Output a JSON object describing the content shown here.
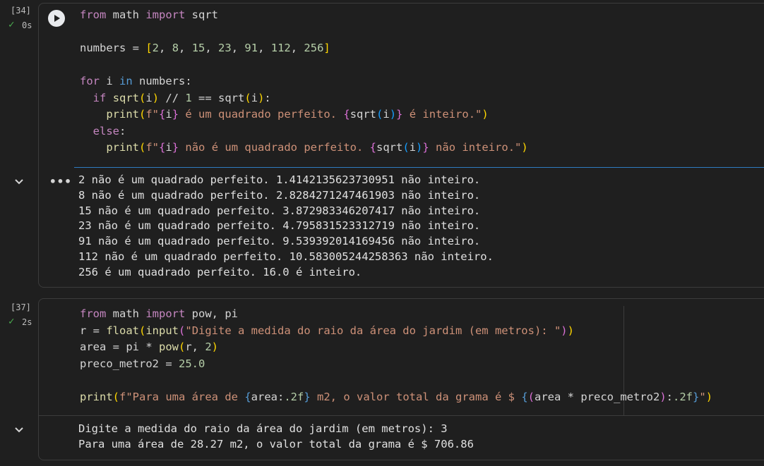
{
  "cell1": {
    "exec_count": "[34]",
    "time": "0s",
    "code": [
      [
        [
          "from",
          "kw"
        ],
        [
          " math ",
          "plain"
        ],
        [
          "import",
          "kw"
        ],
        [
          " sqrt",
          "plain"
        ]
      ],
      [],
      [
        [
          "numbers = ",
          "plain"
        ],
        [
          "[",
          "brk"
        ],
        [
          "2",
          "num"
        ],
        [
          ", ",
          "plain"
        ],
        [
          "8",
          "num"
        ],
        [
          ", ",
          "plain"
        ],
        [
          "15",
          "num"
        ],
        [
          ", ",
          "plain"
        ],
        [
          "23",
          "num"
        ],
        [
          ", ",
          "plain"
        ],
        [
          "91",
          "num"
        ],
        [
          ", ",
          "plain"
        ],
        [
          "112",
          "num"
        ],
        [
          ", ",
          "plain"
        ],
        [
          "256",
          "num"
        ],
        [
          "]",
          "brk"
        ]
      ],
      [],
      [
        [
          "for",
          "kw"
        ],
        [
          " i ",
          "plain"
        ],
        [
          "in",
          "kw2"
        ],
        [
          " numbers:",
          "plain"
        ]
      ],
      [
        [
          "  ",
          "plain"
        ],
        [
          "if",
          "kw"
        ],
        [
          " ",
          "plain"
        ],
        [
          "sqrt",
          "fn"
        ],
        [
          "(",
          "brk"
        ],
        [
          "i",
          "plain"
        ],
        [
          ")",
          "brk"
        ],
        [
          " // ",
          "plain"
        ],
        [
          "1",
          "num"
        ],
        [
          " == sqrt",
          "plain"
        ],
        [
          "(",
          "brk"
        ],
        [
          "i",
          "plain"
        ],
        [
          ")",
          "brk"
        ],
        [
          ":",
          "plain"
        ]
      ],
      [
        [
          "    ",
          "plain"
        ],
        [
          "print",
          "fn"
        ],
        [
          "(",
          "brk"
        ],
        [
          "f\"",
          "str"
        ],
        [
          "{",
          "brk2"
        ],
        [
          "i",
          "plain"
        ],
        [
          "}",
          "brk2"
        ],
        [
          " é um quadrado perfeito. ",
          "str"
        ],
        [
          "{",
          "brk2"
        ],
        [
          "sqrt",
          "plain"
        ],
        [
          "(",
          "brk3"
        ],
        [
          "i",
          "plain"
        ],
        [
          ")",
          "brk3"
        ],
        [
          "}",
          "brk2"
        ],
        [
          " é inteiro.\"",
          "str"
        ],
        [
          ")",
          "brk"
        ]
      ],
      [
        [
          "  ",
          "plain"
        ],
        [
          "else",
          "kw"
        ],
        [
          ":",
          "plain"
        ]
      ],
      [
        [
          "    ",
          "plain"
        ],
        [
          "print",
          "fn"
        ],
        [
          "(",
          "brk"
        ],
        [
          "f\"",
          "str"
        ],
        [
          "{",
          "brk2"
        ],
        [
          "i",
          "plain"
        ],
        [
          "}",
          "brk2"
        ],
        [
          " não é um quadrado perfeito. ",
          "str"
        ],
        [
          "{",
          "brk2"
        ],
        [
          "sqrt",
          "plain"
        ],
        [
          "(",
          "brk3"
        ],
        [
          "i",
          "plain"
        ],
        [
          ")",
          "brk3"
        ],
        [
          "}",
          "brk2"
        ],
        [
          " não inteiro.\"",
          "str"
        ],
        [
          ")",
          "brk"
        ]
      ]
    ],
    "output": [
      "2 não é um quadrado perfeito. 1.4142135623730951 não inteiro.",
      "8 não é um quadrado perfeito. 2.8284271247461903 não inteiro.",
      "15 não é um quadrado perfeito. 3.872983346207417 não inteiro.",
      "23 não é um quadrado perfeito. 4.795831523312719 não inteiro.",
      "91 não é um quadrado perfeito. 9.539392014169456 não inteiro.",
      "112 não é um quadrado perfeito. 10.583005244258363 não inteiro.",
      "256 é um quadrado perfeito. 16.0 é inteiro."
    ]
  },
  "cell2": {
    "exec_count": "[37]",
    "time": "2s",
    "code": [
      [
        [
          "from",
          "kw"
        ],
        [
          " math ",
          "plain"
        ],
        [
          "import",
          "kw"
        ],
        [
          " pow, pi",
          "plain"
        ]
      ],
      [
        [
          "r = ",
          "plain"
        ],
        [
          "float",
          "fn"
        ],
        [
          "(",
          "brk"
        ],
        [
          "input",
          "fn"
        ],
        [
          "(",
          "brk2"
        ],
        [
          "\"Digite a medida do raio da área do jardim (em metros): \"",
          "str"
        ],
        [
          ")",
          "brk2"
        ],
        [
          ")",
          "brk"
        ]
      ],
      [
        [
          "area = pi * ",
          "plain"
        ],
        [
          "pow",
          "fn"
        ],
        [
          "(",
          "brk"
        ],
        [
          "r, ",
          "plain"
        ],
        [
          "2",
          "num"
        ],
        [
          ")",
          "brk"
        ]
      ],
      [
        [
          "preco_metro2 = ",
          "plain"
        ],
        [
          "25.0",
          "num"
        ]
      ],
      [],
      [
        [
          "print",
          "fn"
        ],
        [
          "(",
          "brk"
        ],
        [
          "f\"Para uma área de ",
          "str"
        ],
        [
          "{",
          "kw2"
        ],
        [
          "area:",
          "plain"
        ],
        [
          ".2f",
          "num"
        ],
        [
          "}",
          "kw2"
        ],
        [
          " m2, o valor total da grama é $ ",
          "str"
        ],
        [
          "{",
          "kw2"
        ],
        [
          "(",
          "brk2"
        ],
        [
          "area * preco_metro2",
          "plain"
        ],
        [
          ")",
          "brk2"
        ],
        [
          ":",
          "plain"
        ],
        [
          ".2f",
          "num"
        ],
        [
          "}",
          "kw2"
        ],
        [
          "\"",
          "str"
        ],
        [
          ")",
          "brk"
        ]
      ]
    ],
    "output": [
      "Digite a medida do raio da área do jardim (em metros): 3",
      "Para uma área de 28.27 m2, o valor total da grama é $ 706.86"
    ]
  },
  "icons": {
    "run": "play-icon",
    "check": "check-icon",
    "collapse": "chevron-down-icon",
    "more": "more-horizontal-icon"
  },
  "colors": {
    "background": "#1f1f1f",
    "run_button": "#e8eaed",
    "check": "#4caf50",
    "active_border": "#2f7bc0"
  }
}
